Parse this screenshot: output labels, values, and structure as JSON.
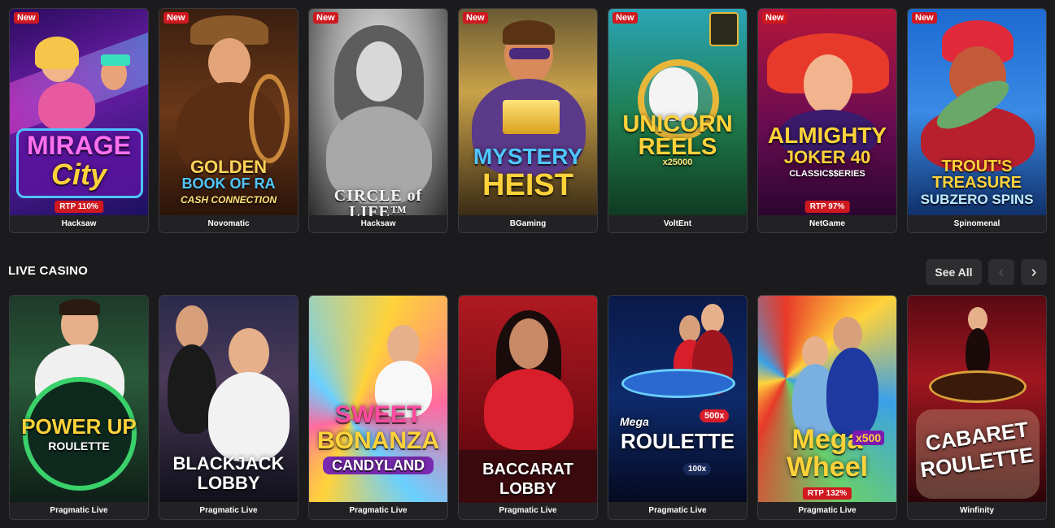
{
  "new_label": "New",
  "top_games": [
    {
      "title_lines": [
        "MIRAGE",
        "City"
      ],
      "provider": "Hacksaw",
      "is_new": true,
      "rtp": "RTP 110%"
    },
    {
      "title_lines": [
        "GOLDEN",
        "BOOK OF RA",
        "CASH CONNECTION"
      ],
      "provider": "Novomatic",
      "is_new": true,
      "rtp": ""
    },
    {
      "title_lines": [
        "CIRCLE of LIFE™"
      ],
      "provider": "Hacksaw",
      "is_new": true,
      "rtp": ""
    },
    {
      "title_lines": [
        "MYSTERY",
        "HEIST"
      ],
      "provider": "BGaming",
      "is_new": true,
      "rtp": ""
    },
    {
      "title_lines": [
        "UNICORN",
        "REELS",
        "x25000"
      ],
      "provider": "VoltEnt",
      "is_new": true,
      "rtp": ""
    },
    {
      "title_lines": [
        "ALMIGHTY",
        "JOKER 40",
        "CLASSIC$$ERIES"
      ],
      "provider": "NetGame",
      "is_new": true,
      "rtp": "RTP 97%"
    },
    {
      "title_lines": [
        "TROUT'S",
        "TREASURE",
        "SUBZERO SPINS"
      ],
      "provider": "Spinomenal",
      "is_new": true,
      "rtp": ""
    }
  ],
  "live_casino": {
    "section_title": "LIVE CASINO",
    "see_all_label": "See All",
    "prev_icon": "‹",
    "next_icon": "›",
    "games": [
      {
        "title_lines": [
          "POWER UP",
          "ROULETTE"
        ],
        "provider": "Pragmatic Live",
        "rtp": ""
      },
      {
        "title_lines": [
          "BLACKJACK",
          "LOBBY"
        ],
        "provider": "Pragmatic Live",
        "rtp": ""
      },
      {
        "title_lines": [
          "SWEET",
          "BONANZA",
          "CANDYLAND"
        ],
        "provider": "Pragmatic Live",
        "rtp": ""
      },
      {
        "title_lines": [
          "BACCARAT",
          "LOBBY"
        ],
        "provider": "Pragmatic Live",
        "rtp": ""
      },
      {
        "title_lines": [
          "Mega",
          "ROULETTE",
          "500x",
          "100x"
        ],
        "provider": "Pragmatic Live",
        "rtp": ""
      },
      {
        "title_lines": [
          "Mega",
          "Wheel",
          "x500"
        ],
        "provider": "Pragmatic Live",
        "rtp": "RTP 132%"
      },
      {
        "title_lines": [
          "CABARET",
          "ROULETTE"
        ],
        "provider": "Winfinity",
        "rtp": ""
      }
    ]
  },
  "colors": {
    "badge": "#d0181f",
    "background": "#1b1b1d",
    "card": "#232326"
  }
}
